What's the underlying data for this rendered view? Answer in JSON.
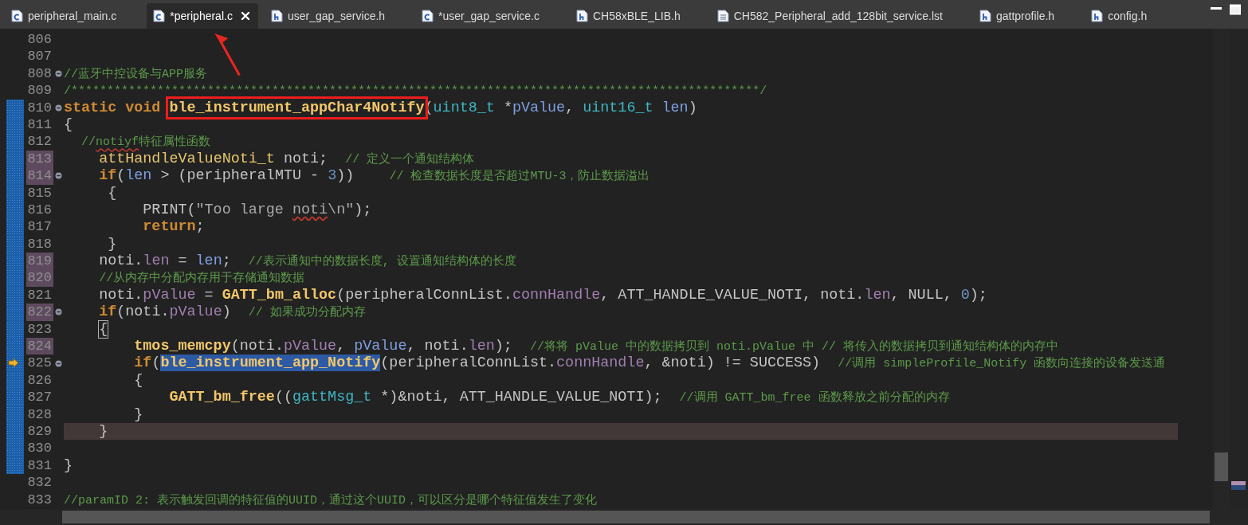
{
  "tabs": [
    {
      "label": "peripheral_main.c",
      "kind": "c",
      "selected": false,
      "pointed": false
    },
    {
      "label": "*peripheral.c",
      "kind": "c",
      "selected": true,
      "pointed": true
    },
    {
      "label": "user_gap_service.h",
      "kind": "h",
      "selected": false,
      "pointed": false
    },
    {
      "label": "*user_gap_service.c",
      "kind": "c",
      "selected": false,
      "pointed": false
    },
    {
      "label": "CH58xBLE_LIB.h",
      "kind": "h",
      "selected": false,
      "pointed": false
    },
    {
      "label": "CH582_Peripheral_add_128bit_service.lst",
      "kind": "doc",
      "selected": false,
      "pointed": false
    },
    {
      "label": "gattprofile.h",
      "kind": "h",
      "selected": false,
      "pointed": false
    },
    {
      "label": "config.h",
      "kind": "h",
      "selected": false,
      "pointed": false
    }
  ],
  "editor": {
    "lines": [
      {
        "number": "806",
        "marked": false,
        "fold": false,
        "changed": false,
        "current": false,
        "exec": false
      },
      {
        "number": "807",
        "marked": false,
        "fold": false,
        "changed": false,
        "current": false,
        "exec": false
      },
      {
        "number": "808",
        "marked": false,
        "fold": true,
        "changed": false,
        "current": false,
        "exec": false,
        "tokens": [
          {
            "text": "//蓝牙中控设备与APP服务",
            "kind": "comment"
          }
        ]
      },
      {
        "number": "809",
        "marked": false,
        "fold": false,
        "changed": false,
        "current": false,
        "exec": false,
        "tokens": [
          {
            "text": "/************************************************************************************************/",
            "kind": "comment"
          }
        ]
      },
      {
        "number": "810",
        "marked": false,
        "fold": true,
        "changed": true,
        "current": false,
        "exec": false,
        "tokens": [
          {
            "text": "static ",
            "kind": "kw"
          },
          {
            "text": "void ",
            "kind": "kw"
          },
          {
            "text": "ble_instrument_appChar4Notify",
            "kind": "fn",
            "outlined": true
          },
          {
            "text": "(",
            "kind": "plain"
          },
          {
            "text": "uint8_t",
            "kind": "type"
          },
          {
            "text": " *",
            "kind": "plain"
          },
          {
            "text": "pValue",
            "kind": "param"
          },
          {
            "text": ", ",
            "kind": "plain"
          },
          {
            "text": "uint16_t ",
            "kind": "type"
          },
          {
            "text": "len",
            "kind": "param"
          },
          {
            "text": ")",
            "kind": "plain"
          }
        ]
      },
      {
        "number": "811",
        "marked": false,
        "fold": false,
        "changed": true,
        "current": false,
        "exec": false,
        "tokens": [
          {
            "text": "{",
            "kind": "plain"
          }
        ]
      },
      {
        "number": "812",
        "marked": false,
        "fold": false,
        "changed": true,
        "current": false,
        "exec": false,
        "tokens": [
          {
            "text": "  //",
            "kind": "comment"
          },
          {
            "text": "notiyf",
            "kind": "comment",
            "misspelled": true
          },
          {
            "text": "特征属性函数",
            "kind": "comment"
          }
        ]
      },
      {
        "number": "813",
        "marked": true,
        "fold": false,
        "changed": true,
        "current": false,
        "exec": false,
        "tokens": [
          {
            "text": "    attHandleValueNoti_t",
            "kind": "typedef"
          },
          {
            "text": " noti;  ",
            "kind": "plain"
          },
          {
            "text": "// 定义一个通知结构体",
            "kind": "comment"
          }
        ]
      },
      {
        "number": "814",
        "marked": true,
        "fold": true,
        "changed": true,
        "current": false,
        "exec": false,
        "tokens": [
          {
            "text": "    if",
            "kind": "kw"
          },
          {
            "text": "(",
            "kind": "plain"
          },
          {
            "text": "len",
            "kind": "param"
          },
          {
            "text": " > (peripheralMTU - ",
            "kind": "plain"
          },
          {
            "text": "3",
            "kind": "num"
          },
          {
            "text": "))    ",
            "kind": "plain"
          },
          {
            "text": "// 检查数据长度是否超过MTU-3，防止数据溢出",
            "kind": "comment"
          }
        ]
      },
      {
        "number": "815",
        "marked": false,
        "fold": false,
        "changed": true,
        "current": false,
        "exec": false,
        "tokens": [
          {
            "text": "     {",
            "kind": "plain"
          }
        ]
      },
      {
        "number": "816",
        "marked": false,
        "fold": false,
        "changed": true,
        "current": false,
        "exec": false,
        "tokens": [
          {
            "text": "         PRINT(",
            "kind": "plain"
          },
          {
            "text": "\"Too large ",
            "kind": "str"
          },
          {
            "text": "noti",
            "kind": "str",
            "misspelled": true
          },
          {
            "text": "\\n\"",
            "kind": "str"
          },
          {
            "text": ");",
            "kind": "plain"
          }
        ]
      },
      {
        "number": "817",
        "marked": false,
        "fold": false,
        "changed": true,
        "current": false,
        "exec": false,
        "tokens": [
          {
            "text": "         return",
            "kind": "kw"
          },
          {
            "text": ";",
            "kind": "plain"
          }
        ]
      },
      {
        "number": "818",
        "marked": false,
        "fold": false,
        "changed": true,
        "current": false,
        "exec": false,
        "tokens": [
          {
            "text": "     }",
            "kind": "plain"
          }
        ]
      },
      {
        "number": "819",
        "marked": true,
        "fold": false,
        "changed": true,
        "current": false,
        "exec": false,
        "tokens": [
          {
            "text": "    noti.",
            "kind": "plain"
          },
          {
            "text": "len",
            "kind": "field"
          },
          {
            "text": " = ",
            "kind": "plain"
          },
          {
            "text": "len",
            "kind": "param"
          },
          {
            "text": ";  ",
            "kind": "plain"
          },
          {
            "text": "//表示通知中的数据长度, 设置通知结构体的长度",
            "kind": "comment"
          }
        ]
      },
      {
        "number": "820",
        "marked": true,
        "fold": false,
        "changed": true,
        "current": false,
        "exec": false,
        "tokens": [
          {
            "text": "    //从内存中分配内存用于存储通知数据",
            "kind": "comment"
          }
        ]
      },
      {
        "number": "821",
        "marked": false,
        "fold": false,
        "changed": true,
        "current": false,
        "exec": false,
        "tokens": [
          {
            "text": "    noti.",
            "kind": "plain"
          },
          {
            "text": "pValue",
            "kind": "field"
          },
          {
            "text": " = ",
            "kind": "plain"
          },
          {
            "text": "GATT_bm_alloc",
            "kind": "fn"
          },
          {
            "text": "(peripheralConnList.",
            "kind": "plain"
          },
          {
            "text": "connHandle",
            "kind": "field"
          },
          {
            "text": ", ATT_HANDLE_VALUE_NOTI, noti.",
            "kind": "plain"
          },
          {
            "text": "len",
            "kind": "field"
          },
          {
            "text": ", NULL, ",
            "kind": "plain"
          },
          {
            "text": "0",
            "kind": "num"
          },
          {
            "text": ");",
            "kind": "plain"
          }
        ]
      },
      {
        "number": "822",
        "marked": true,
        "fold": true,
        "changed": true,
        "current": false,
        "exec": false,
        "tokens": [
          {
            "text": "    if",
            "kind": "kw"
          },
          {
            "text": "(noti.",
            "kind": "plain"
          },
          {
            "text": "pValue",
            "kind": "field"
          },
          {
            "text": ")  ",
            "kind": "plain"
          },
          {
            "text": "// 如果成功分配内存",
            "kind": "comment"
          }
        ]
      },
      {
        "number": "823",
        "marked": false,
        "fold": false,
        "changed": true,
        "current": false,
        "exec": false,
        "tokens": [
          {
            "text": "    {",
            "kind": "plain",
            "matched": true
          }
        ]
      },
      {
        "number": "824",
        "marked": true,
        "fold": false,
        "changed": true,
        "current": false,
        "exec": false,
        "tokens": [
          {
            "text": "        tmos_memcpy",
            "kind": "fn"
          },
          {
            "text": "(noti.",
            "kind": "plain"
          },
          {
            "text": "pValue",
            "kind": "field"
          },
          {
            "text": ", ",
            "kind": "plain"
          },
          {
            "text": "pValue",
            "kind": "param"
          },
          {
            "text": ", noti.",
            "kind": "plain"
          },
          {
            "text": "len",
            "kind": "field"
          },
          {
            "text": ");  ",
            "kind": "plain"
          },
          {
            "text": "//将将 pValue 中的数据拷贝到 noti.pValue 中 // 将传入的数据拷贝到通知结构体的内存中",
            "kind": "comment"
          }
        ]
      },
      {
        "number": "825",
        "marked": false,
        "fold": true,
        "changed": true,
        "current": false,
        "exec": true,
        "tokens": [
          {
            "text": "        if",
            "kind": "kw"
          },
          {
            "text": "(",
            "kind": "plain"
          },
          {
            "text": "ble_instrument_app_Notify",
            "kind": "fn",
            "selected": true
          },
          {
            "text": "(peripheralConnList.",
            "kind": "plain"
          },
          {
            "text": "connHandle",
            "kind": "field"
          },
          {
            "text": ", &noti) != SUCCESS)  ",
            "kind": "plain"
          },
          {
            "text": "//调用 simpleProfile_Notify 函数向连接的设备发送通",
            "kind": "comment"
          }
        ]
      },
      {
        "number": "826",
        "marked": false,
        "fold": false,
        "changed": true,
        "current": false,
        "exec": false,
        "tokens": [
          {
            "text": "        {",
            "kind": "plain"
          }
        ]
      },
      {
        "number": "827",
        "marked": false,
        "fold": false,
        "changed": true,
        "current": false,
        "exec": false,
        "tokens": [
          {
            "text": "            GATT_bm_free",
            "kind": "fn"
          },
          {
            "text": "((",
            "kind": "plain"
          },
          {
            "text": "gattMsg_t",
            "kind": "type"
          },
          {
            "text": " *)&noti, ATT_HANDLE_VALUE_NOTI);  ",
            "kind": "plain"
          },
          {
            "text": "//调用 GATT_bm_free 函数释放之前分配的内存",
            "kind": "comment"
          }
        ]
      },
      {
        "number": "828",
        "marked": false,
        "fold": false,
        "changed": true,
        "current": false,
        "exec": false,
        "tokens": [
          {
            "text": "        }",
            "kind": "plain"
          }
        ]
      },
      {
        "number": "829",
        "marked": false,
        "fold": false,
        "changed": true,
        "current": true,
        "exec": false,
        "tokens": [
          {
            "text": "    }",
            "kind": "plain"
          }
        ]
      },
      {
        "number": "830",
        "marked": false,
        "fold": false,
        "changed": true,
        "current": false,
        "exec": false
      },
      {
        "number": "831",
        "marked": false,
        "fold": false,
        "changed": true,
        "current": false,
        "exec": false,
        "tokens": [
          {
            "text": "}",
            "kind": "plain"
          }
        ]
      },
      {
        "number": "832",
        "marked": false,
        "fold": false,
        "changed": false,
        "current": false,
        "exec": false
      },
      {
        "number": "833",
        "marked": false,
        "fold": false,
        "changed": false,
        "current": false,
        "exec": false,
        "tokens": [
          {
            "text": "//paramID 2: 表示触发回调的特征值的UUID，通过这个UUID，可以区分是哪个特征值发生了变化",
            "kind": "comment"
          }
        ]
      }
    ]
  }
}
